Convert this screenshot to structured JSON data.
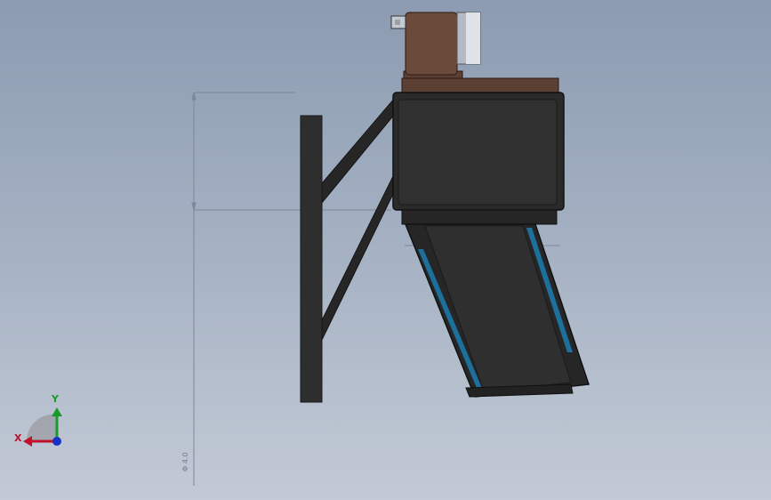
{
  "viewport": {
    "background_top": "#8c9bb1",
    "background_bottom": "#c3cad6"
  },
  "dimension": {
    "label": "Φ 4.0"
  },
  "triad": {
    "x_label": "X",
    "y_label": "Y",
    "x_color": "#c0102a",
    "y_color": "#1a9a2a",
    "z_color": "#1630c8"
  },
  "model": {
    "motor_color": "#6b4a3c",
    "body_color": "#2c2c2c",
    "belt_color": "#1d6f9c",
    "icons": [
      "motor-icon",
      "shaft-icon"
    ]
  }
}
